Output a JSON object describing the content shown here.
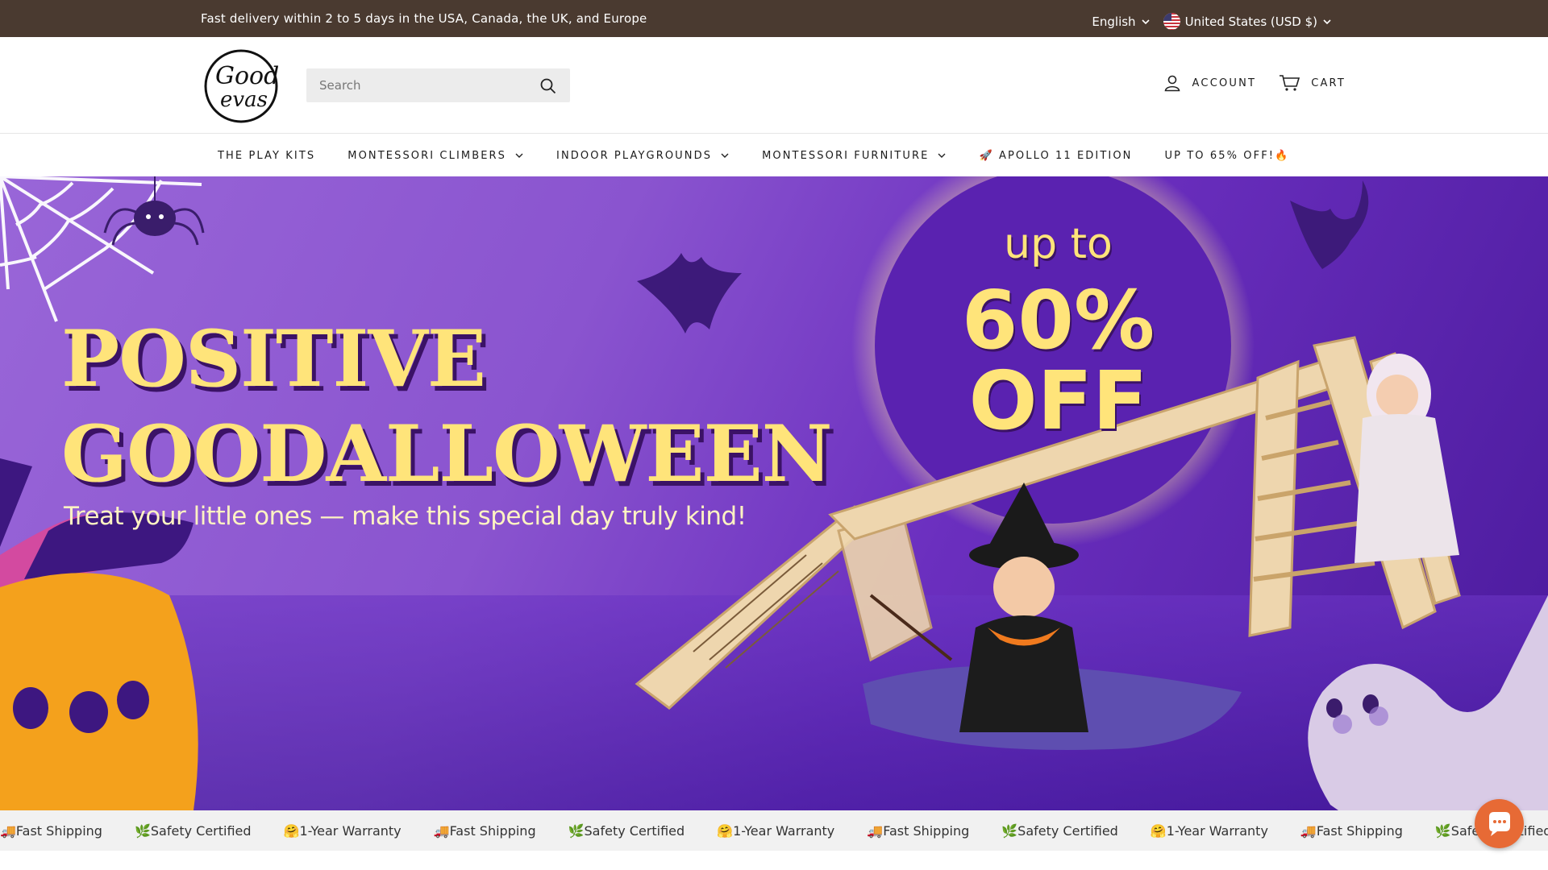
{
  "announcement": {
    "text": "Fast delivery within 2 to 5 days in the USA, Canada, the UK, and Europe",
    "language": "English",
    "country": "United States (USD $)"
  },
  "header": {
    "logo_alt": "Good evas",
    "search_placeholder": "Search",
    "account_label": "ACCOUNT",
    "cart_label": "CART"
  },
  "nav": {
    "items": [
      {
        "label": "THE PLAY KITS",
        "has_dropdown": false
      },
      {
        "label": "MONTESSORI CLIMBERS",
        "has_dropdown": true
      },
      {
        "label": "INDOOR PLAYGROUNDS",
        "has_dropdown": true
      },
      {
        "label": "MONTESSORI FURNITURE",
        "has_dropdown": true
      },
      {
        "label": "🚀 APOLLO 11 EDITION",
        "has_dropdown": false
      },
      {
        "label": "UP TO 65% OFF!🔥",
        "has_dropdown": false
      }
    ]
  },
  "hero": {
    "title_line1": "POSITIVE",
    "title_line2": "GOODALLOWEEN",
    "subtitle": "Treat your little ones — make this special day truly kind!",
    "badge_line1": "up to",
    "badge_line2": "60%",
    "badge_line3": "OFF"
  },
  "features": {
    "items": [
      "🚚Fast Shipping",
      "🌿Safety Certified",
      "🤗1-Year Warranty",
      "🚚Fast Shipping",
      "🌿Safety Certified",
      "🤗1-Year Warranty",
      "🚚Fast Shipping",
      "🌿Safety Certified",
      "🤗1-Year Warranty",
      "🚚Fast Shipping",
      "🌿Safety Certified",
      "🤗"
    ]
  },
  "colors": {
    "announcement_bg": "#4a3a30",
    "hero_purple": "#8a54cf",
    "hero_yellow": "#ffe47a",
    "chat_orange": "#e76a35"
  },
  "icons": [
    "chevron-down-icon",
    "us-flag-icon",
    "search-icon",
    "account-icon",
    "cart-icon",
    "chat-icon"
  ]
}
